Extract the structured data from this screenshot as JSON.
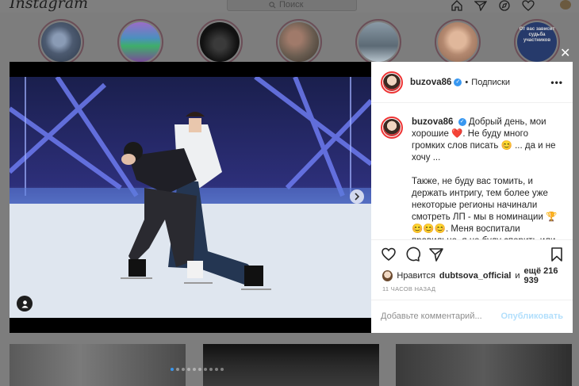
{
  "app": {
    "logo": "Instagram"
  },
  "search": {
    "placeholder": "Поиск",
    "icon": "search-icon"
  },
  "nav_icons": [
    "home-icon",
    "direct-icon",
    "explore-icon",
    "heart-icon"
  ],
  "stories": [
    {
      "id": "s1",
      "color": "#4c5a70"
    },
    {
      "id": "s2",
      "color": "#6e4f88"
    },
    {
      "id": "s3",
      "color": "#1b1b1b"
    },
    {
      "id": "s4",
      "color": "#695c50"
    },
    {
      "id": "s5",
      "color": "#5c6a75"
    },
    {
      "id": "s6",
      "color": "#b48970"
    },
    {
      "id": "s7",
      "color": "#263a6b",
      "text": "От вас зависит судьба участников"
    }
  ],
  "post": {
    "username": "buzova86",
    "verified": true,
    "follow_label": "Подписки",
    "more_icon": "more-icon",
    "caption_p1": "Добрый день, мои хорошие ❤️. Не буду много громких слов писать 😊 ... да и не хочу ...",
    "caption_p2": "Также, не буду вас томить, и держать интригу, тем более уже некоторые регионы начинали смотреть ЛП - мы в номинации 🏆 😊😊😊. Меня воспитали правильно, я не буду спорить или обсуждать оценки жюри. Но они",
    "likes_prefix": "Нравится",
    "liked_by": "dubtsova_official",
    "likes_and": "и",
    "likes_more": "ещё 216 939",
    "time": "11 ЧАСОВ НАЗАД",
    "comment_placeholder": "Добавьте комментарий...",
    "publish_label": "Опубликовать",
    "carousel": {
      "count": 10,
      "active": 1
    }
  },
  "colors": {
    "accent": "#3897f0",
    "publish_disabled": "#b2dffc",
    "heart": "#ed4956"
  }
}
